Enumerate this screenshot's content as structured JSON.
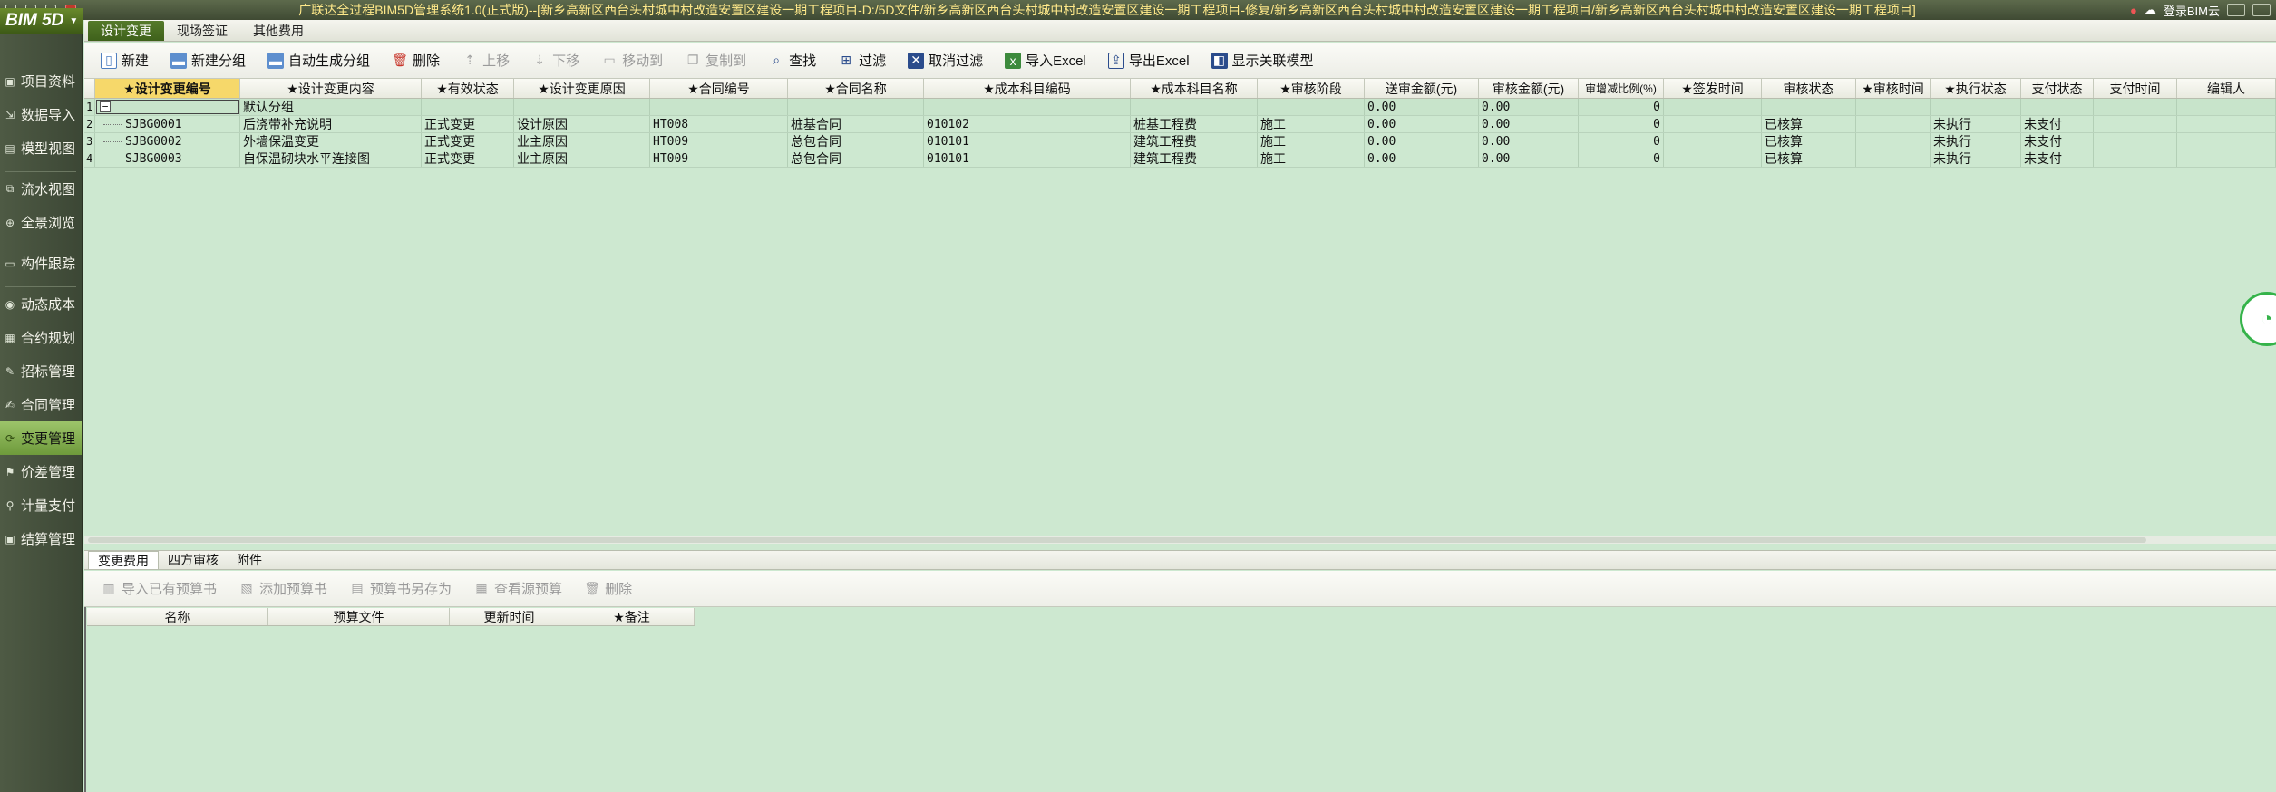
{
  "window": {
    "title": "广联达全过程BIM5D管理系统1.0(正式版)--[新乡高新区西台头村城中村改造安置区建设一期工程项目-D:/5D文件/新乡高新区西台头村城中村改造安置区建设一期工程项目-修复/新乡高新区西台头村城中村改造安置区建设一期工程项目/新乡高新区西台头村城中村改造安置区建设一期工程项目]",
    "login_label": "登录BIM云"
  },
  "logo": {
    "text": "BIM 5D",
    "drop": "▼"
  },
  "sidebar": {
    "items": [
      {
        "label": "项目资料",
        "icon": "folder-icon"
      },
      {
        "label": "数据导入",
        "icon": "import-icon"
      },
      {
        "label": "模型视图",
        "icon": "model-icon"
      },
      {
        "label": "流水视图",
        "icon": "flow-icon"
      },
      {
        "label": "全景浏览",
        "icon": "panorama-icon"
      },
      {
        "label": "构件跟踪",
        "icon": "tracking-icon"
      },
      {
        "label": "动态成本",
        "icon": "cost-icon"
      },
      {
        "label": "合约规划",
        "icon": "contract-plan-icon"
      },
      {
        "label": "招标管理",
        "icon": "bidding-icon"
      },
      {
        "label": "合同管理",
        "icon": "contract-icon"
      },
      {
        "label": "变更管理",
        "icon": "change-icon"
      },
      {
        "label": "价差管理",
        "icon": "price-diff-icon"
      },
      {
        "label": "计量支付",
        "icon": "payment-icon"
      },
      {
        "label": "结算管理",
        "icon": "settlement-icon"
      }
    ]
  },
  "tabs": [
    {
      "label": "设计变更"
    },
    {
      "label": "现场签证"
    },
    {
      "label": "其他费用"
    }
  ],
  "toolbar": {
    "new": "新建",
    "new_group": "新建分组",
    "auto_group": "自动生成分组",
    "delete": "删除",
    "move_up": "上移",
    "move_down": "下移",
    "move_to": "移动到",
    "copy_to": "复制到",
    "find": "查找",
    "filter": "过滤",
    "cancel_filter": "取消过滤",
    "import_excel": "导入Excel",
    "export_excel": "导出Excel",
    "show_model": "显示关联模型"
  },
  "grid": {
    "columns": [
      "★设计变更编号",
      "★设计变更内容",
      "★有效状态",
      "★设计变更原因",
      "★合同编号",
      "★合同名称",
      "★成本科目编码",
      "★成本科目名称",
      "★审核阶段",
      "送审金额(元)",
      "审核金额(元)",
      "审增减比例(%)",
      "★签发时间",
      "审核状态",
      "★审核时间",
      "★执行状态",
      "支付状态",
      "支付时间",
      "编辑人"
    ],
    "group_row": {
      "num": "1",
      "expander": "−",
      "name": "默认分组",
      "amount": "0.00",
      "audit": "0.00",
      "ratio": "0"
    },
    "rows": [
      {
        "num": "2",
        "code": "SJBG0001",
        "content": "后浇带补充说明",
        "status": "正式变更",
        "reason": "设计原因",
        "contract_no": "HT008",
        "contract_name": "桩基合同",
        "cost_code": "010102",
        "cost_name": "桩基工程费",
        "stage": "施工",
        "amount": "0.00",
        "audit": "0.00",
        "ratio": "0",
        "sign_time": "",
        "audit_status": "已核算",
        "audit_time": "",
        "exec": "未执行",
        "pay": "未支付",
        "pay_time": "",
        "editor": ""
      },
      {
        "num": "3",
        "code": "SJBG0002",
        "content": "外墙保温变更",
        "status": "正式变更",
        "reason": "业主原因",
        "contract_no": "HT009",
        "contract_name": "总包合同",
        "cost_code": "010101",
        "cost_name": "建筑工程费",
        "stage": "施工",
        "amount": "0.00",
        "audit": "0.00",
        "ratio": "0",
        "sign_time": "",
        "audit_status": "已核算",
        "audit_time": "",
        "exec": "未执行",
        "pay": "未支付",
        "pay_time": "",
        "editor": ""
      },
      {
        "num": "4",
        "code": "SJBG0003",
        "content": "自保温砌块水平连接图",
        "status": "正式变更",
        "reason": "业主原因",
        "contract_no": "HT009",
        "contract_name": "总包合同",
        "cost_code": "010101",
        "cost_name": "建筑工程费",
        "stage": "施工",
        "amount": "0.00",
        "audit": "0.00",
        "ratio": "0",
        "sign_time": "",
        "audit_status": "已核算",
        "audit_time": "",
        "exec": "未执行",
        "pay": "未支付",
        "pay_time": "",
        "editor": ""
      }
    ]
  },
  "bottom": {
    "tabs": [
      {
        "label": "变更费用"
      },
      {
        "label": "四方审核"
      },
      {
        "label": "附件"
      }
    ],
    "toolbar": {
      "import_budget": "导入已有预算书",
      "add_budget": "添加预算书",
      "save_as": "预算书另存为",
      "view_source": "查看源预算",
      "delete": "删除"
    },
    "columns": [
      "名称",
      "预算文件",
      "更新时间",
      "★备注"
    ]
  }
}
